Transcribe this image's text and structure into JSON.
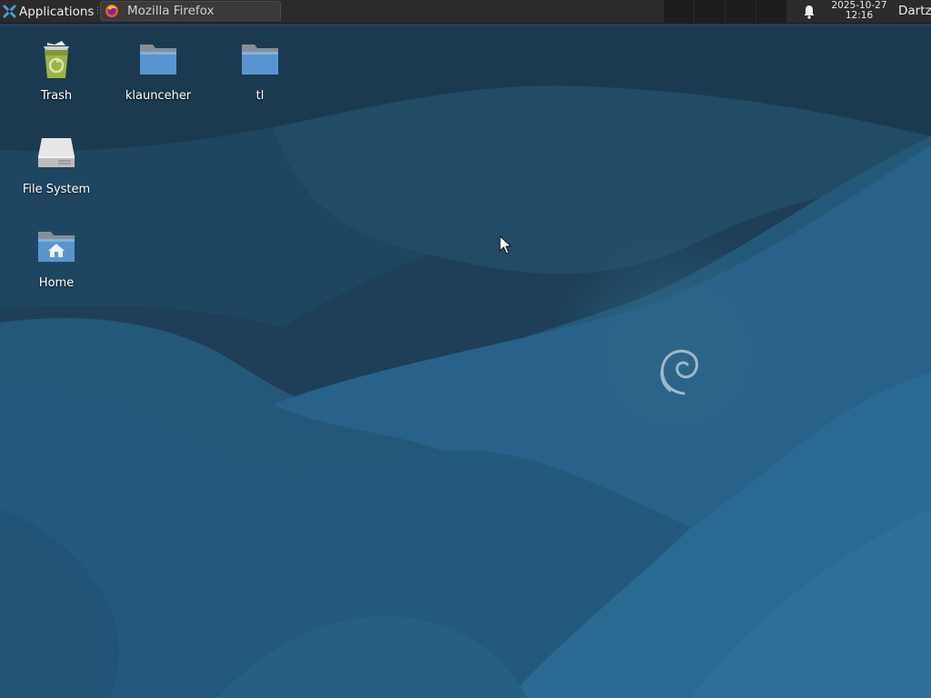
{
  "panel": {
    "applications_label": "Applications",
    "separator": "⋮",
    "tasks": [
      {
        "label": "Mozilla Firefox",
        "icon": "firefox-icon"
      }
    ],
    "workspaces_count": 4,
    "clock": {
      "date": "2025-10-27",
      "time": "12:16"
    },
    "user": "Dartz"
  },
  "desktop": {
    "icons": [
      {
        "label": "Trash",
        "icon": "trash-icon"
      },
      {
        "label": "klaunceher",
        "icon": "folder-icon"
      },
      {
        "label": "tl",
        "icon": "folder-icon"
      },
      {
        "label": "File System",
        "icon": "drive-icon"
      },
      {
        "label": "Home",
        "icon": "home-folder-icon"
      }
    ]
  },
  "colors": {
    "panel_bg": "#2b2b2b",
    "wallpaper_dark": "#1f4660",
    "wallpaper_light": "#2a6a91",
    "folder_blue": "#5a94d0"
  }
}
